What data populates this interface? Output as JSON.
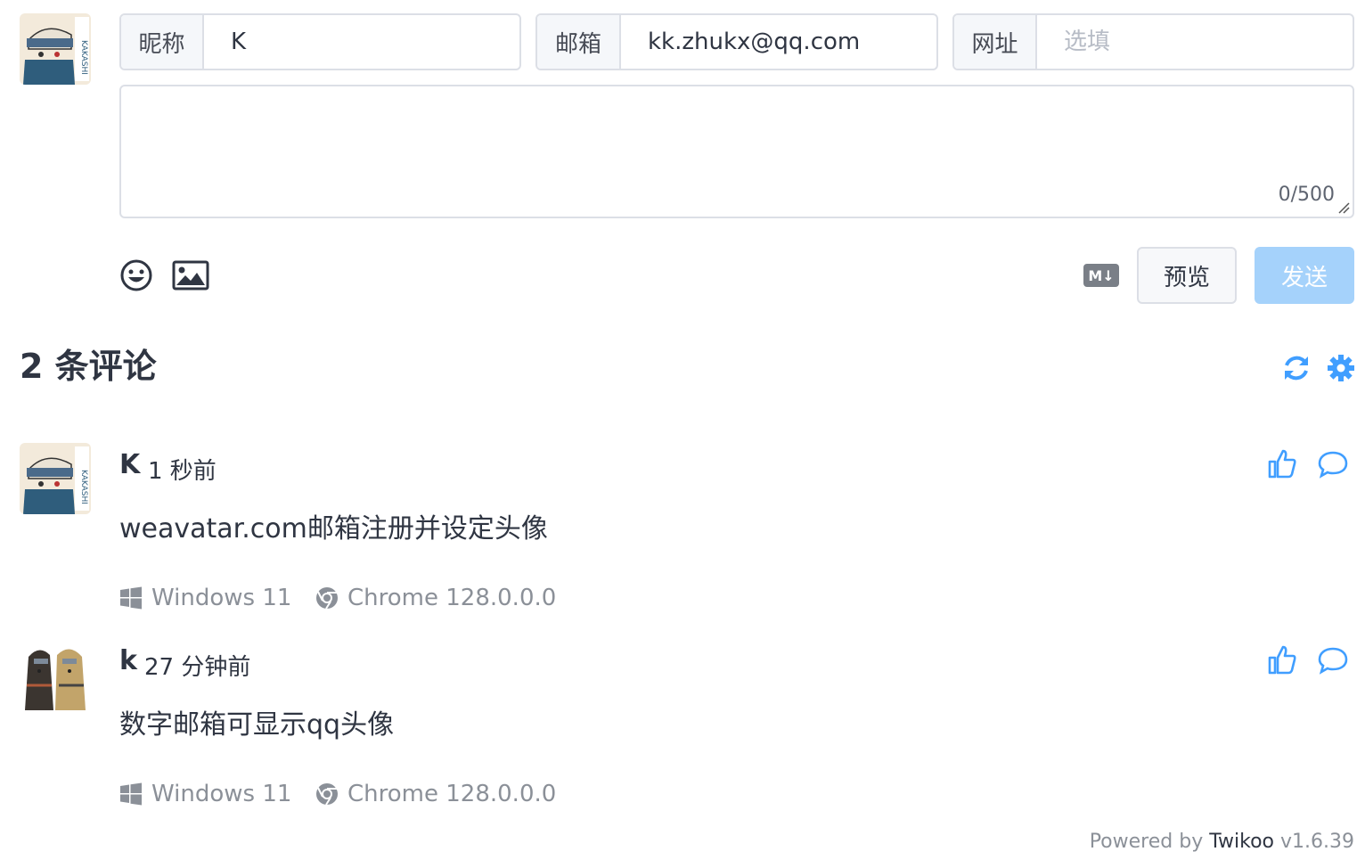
{
  "form": {
    "nick_label": "昵称",
    "nick_value": "K",
    "mail_label": "邮箱",
    "mail_value": "kk.zhukx@qq.com",
    "link_label": "网址",
    "link_placeholder": "选填",
    "counter": "0/500",
    "markdown_badge": "M↓",
    "preview_label": "预览",
    "send_label": "发送"
  },
  "header": {
    "count_title": "2 条评论"
  },
  "comments": [
    {
      "nick": "K",
      "time": "1 秒前",
      "content": "weavatar.com邮箱注册并设定头像",
      "os": "Windows 11",
      "browser": "Chrome 128.0.0.0"
    },
    {
      "nick": "k",
      "time": "27 分钟前",
      "content": "数字邮箱可显示qq头像",
      "os": "Windows 11",
      "browser": "Chrome 128.0.0.0"
    }
  ],
  "footer": {
    "powered_by": "Powered by ",
    "brand": "Twikoo",
    "version": " v1.6.39"
  },
  "colors": {
    "accent": "#409eff",
    "send_disabled": "#a5d2fb",
    "border": "#dcdfe6",
    "muted_text": "#8b9098"
  }
}
